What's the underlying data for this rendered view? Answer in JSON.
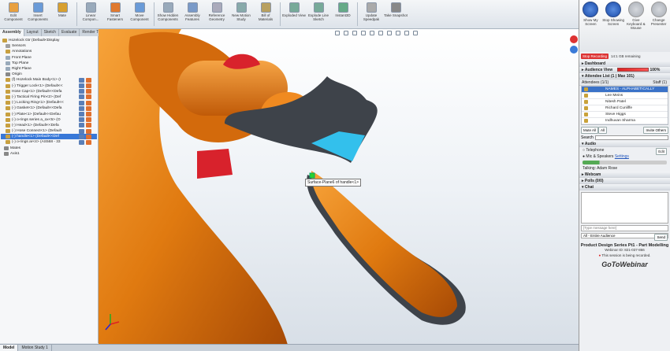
{
  "ribbon": {
    "buttons": [
      "Edit Component",
      "Insert Components",
      "Mate",
      "Linear Compon...",
      "Smart Fasteners",
      "Move Component",
      "Show Hidden Components",
      "Assembly Features",
      "Reference Geometry",
      "New Motion Study",
      "Bill of Materials",
      "Exploded View",
      "Explode Line Sketch",
      "Instant3D",
      "Update Speedpak",
      "Take Snapshot"
    ]
  },
  "tabs": [
    "Assembly",
    "Layout",
    "Sketch",
    "Evaluate",
    "Render Tools"
  ],
  "tree": {
    "items": [
      {
        "label": "Hozelock Gtr (Default<Display",
        "color": "#c8a040"
      },
      {
        "label": "Sensors",
        "color": "#a0a0a0"
      },
      {
        "label": "Annotations",
        "color": "#c8a040"
      },
      {
        "label": "Front Plane",
        "color": "#9ab"
      },
      {
        "label": "Top Plane",
        "color": "#9ab"
      },
      {
        "label": "Right Plane",
        "color": "#9ab"
      },
      {
        "label": "Origin",
        "color": "#888"
      },
      {
        "label": "(f) Hozelock Main Body<1> (I",
        "color": "#c8a040"
      },
      {
        "label": "(-) Trigger Lock<1> (Default<<",
        "color": "#c8a040"
      },
      {
        "label": "Hose Cap<1> (Default<<Defa",
        "color": "#c8a040"
      },
      {
        "label": "(-) Tactical Firing Pin<2> (Def",
        "color": "#c8a040"
      },
      {
        "label": "(-) Locking Ring<1> (Default<<",
        "color": "#c8a040"
      },
      {
        "label": "(-) Gasket<1> (Default<<Defa",
        "color": "#c8a040"
      },
      {
        "label": "(-) Plate<1> (Default<<Defau",
        "color": "#c8a040"
      },
      {
        "label": "(-) o-rings series a_ox<5> (O",
        "color": "#c8a040"
      },
      {
        "label": "(-) Head<1> (Default<<Defa",
        "color": "#c8a040"
      },
      {
        "label": "(-) Hose Connect<1> (Default",
        "color": "#c8a040"
      },
      {
        "label": "(-) handle<1> (Default<<Def",
        "color": "#c8a040"
      },
      {
        "label": "(-) o-rings ar<4> (AS568 - 33",
        "color": "#c8a040"
      },
      {
        "label": "Mates",
        "color": "#888"
      },
      {
        "label": "Axis1",
        "color": "#888"
      }
    ]
  },
  "viewport": {
    "tooltip": "Surface-Plane6 of handle<1>"
  },
  "status": {
    "tabs": [
      "Model",
      "Motion Study 1"
    ]
  },
  "gotowebinar": {
    "top": [
      "Show My Screen",
      "Stop Showing Screen",
      "Give Keyboard & Mouse",
      "Change Presenter"
    ],
    "rec_label": "Stop Recording",
    "rec_time": "14:1 GB remaining",
    "dashboard": "Dashboard",
    "audience_view": "Audience View",
    "audience_pct": "100%",
    "attendee_list": "Attendee List",
    "attendee_count": "(1 | Max 101)",
    "attendees_tab": "Attendees (1/1)",
    "staff_tab": "Staff (1)",
    "names_hdr": "NAMES - ALPHABETICALLY",
    "names": [
      "Lee Meins",
      "Nitesh Patel",
      "Richard Cunliffe",
      "Steve Higgs",
      "Indhuvan Sharma"
    ],
    "mute_all": "Mute All",
    "unmute": "All",
    "invite": "Invite Others",
    "search": "Search",
    "audio": "Audio",
    "telephone": "Telephone",
    "mic": "Mic & Speakers",
    "settings": "Settings",
    "edit": "Edit",
    "talking": "Talking: Adam Rose",
    "webcam": "Webcam",
    "polls": "Polls (0/0)",
    "chat": "Chat",
    "type_message": "[Type message here]",
    "audience_select": "All - Entire Audience",
    "send": "Send",
    "webinar_title": "Product Design Series Pt1 - Part Modelling",
    "webinar_id": "Webinar ID: 821-037-866",
    "rec_notice": "This session is being recorded.",
    "logo": "GoToWebinar"
  }
}
